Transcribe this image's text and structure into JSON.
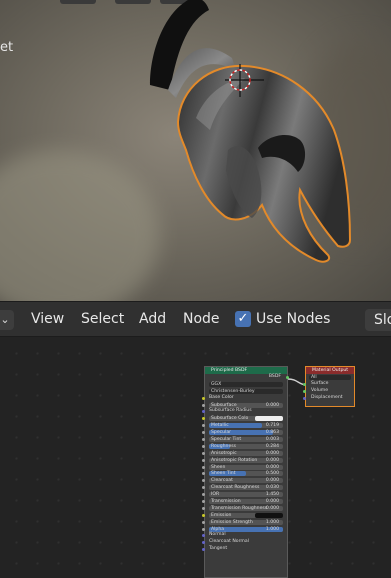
{
  "viewport": {
    "partial_label": "et"
  },
  "header": {
    "editor_icon": "chevron-down-icon",
    "menu": [
      "View",
      "Select",
      "Add",
      "Node"
    ],
    "use_nodes_label": "Use Nodes",
    "use_nodes_checked": true,
    "slot_label": "Slo"
  },
  "bsdf_node": {
    "title": "Principled BSDF",
    "output_label": "BSDF",
    "distribution": "GGX",
    "subsurface_method": "Christensen-Burley",
    "rows": [
      {
        "label": "Base Color",
        "value": ""
      },
      {
        "label": "Subsurface",
        "value": "0.000"
      },
      {
        "label": "Subsurface Radius",
        "value": ""
      },
      {
        "label": "Subsurface Colo",
        "value": ""
      },
      {
        "label": "Metallic",
        "value": "0.719",
        "fill": 0.719
      },
      {
        "label": "Specular",
        "value": "0.863",
        "fill": 0.863
      },
      {
        "label": "Specular Tint",
        "value": "0.003"
      },
      {
        "label": "Roughness",
        "value": "0.284",
        "fill": 0.284
      },
      {
        "label": "Anisotropic",
        "value": "0.000"
      },
      {
        "label": "Anisotropic Rotation",
        "value": "0.000"
      },
      {
        "label": "Sheen",
        "value": "0.000"
      },
      {
        "label": "Sheen Tint",
        "value": "0.500",
        "fill": 0.5
      },
      {
        "label": "Clearcoat",
        "value": "0.000"
      },
      {
        "label": "Clearcoat Roughness",
        "value": "0.030"
      },
      {
        "label": "IOR",
        "value": "1.450"
      },
      {
        "label": "Transmission",
        "value": "0.000"
      },
      {
        "label": "Transmission Roughness",
        "value": "0.000"
      },
      {
        "label": "Emission",
        "value": ""
      },
      {
        "label": "Emission Strength",
        "value": "1.000"
      },
      {
        "label": "Alpha",
        "value": "1.000",
        "fill": 1.0
      },
      {
        "label": "Normal",
        "value": ""
      },
      {
        "label": "Clearcoat Normal",
        "value": ""
      },
      {
        "label": "Tangent",
        "value": ""
      }
    ]
  },
  "output_node": {
    "title": "Material Output",
    "target": "All",
    "sockets": [
      "Surface",
      "Volume",
      "Displacement"
    ]
  },
  "colors": {
    "accent": "#4772b3",
    "selection": "#e38a2a",
    "shader_header": "#1e6b4a",
    "output_header": "#8a2c2c"
  }
}
